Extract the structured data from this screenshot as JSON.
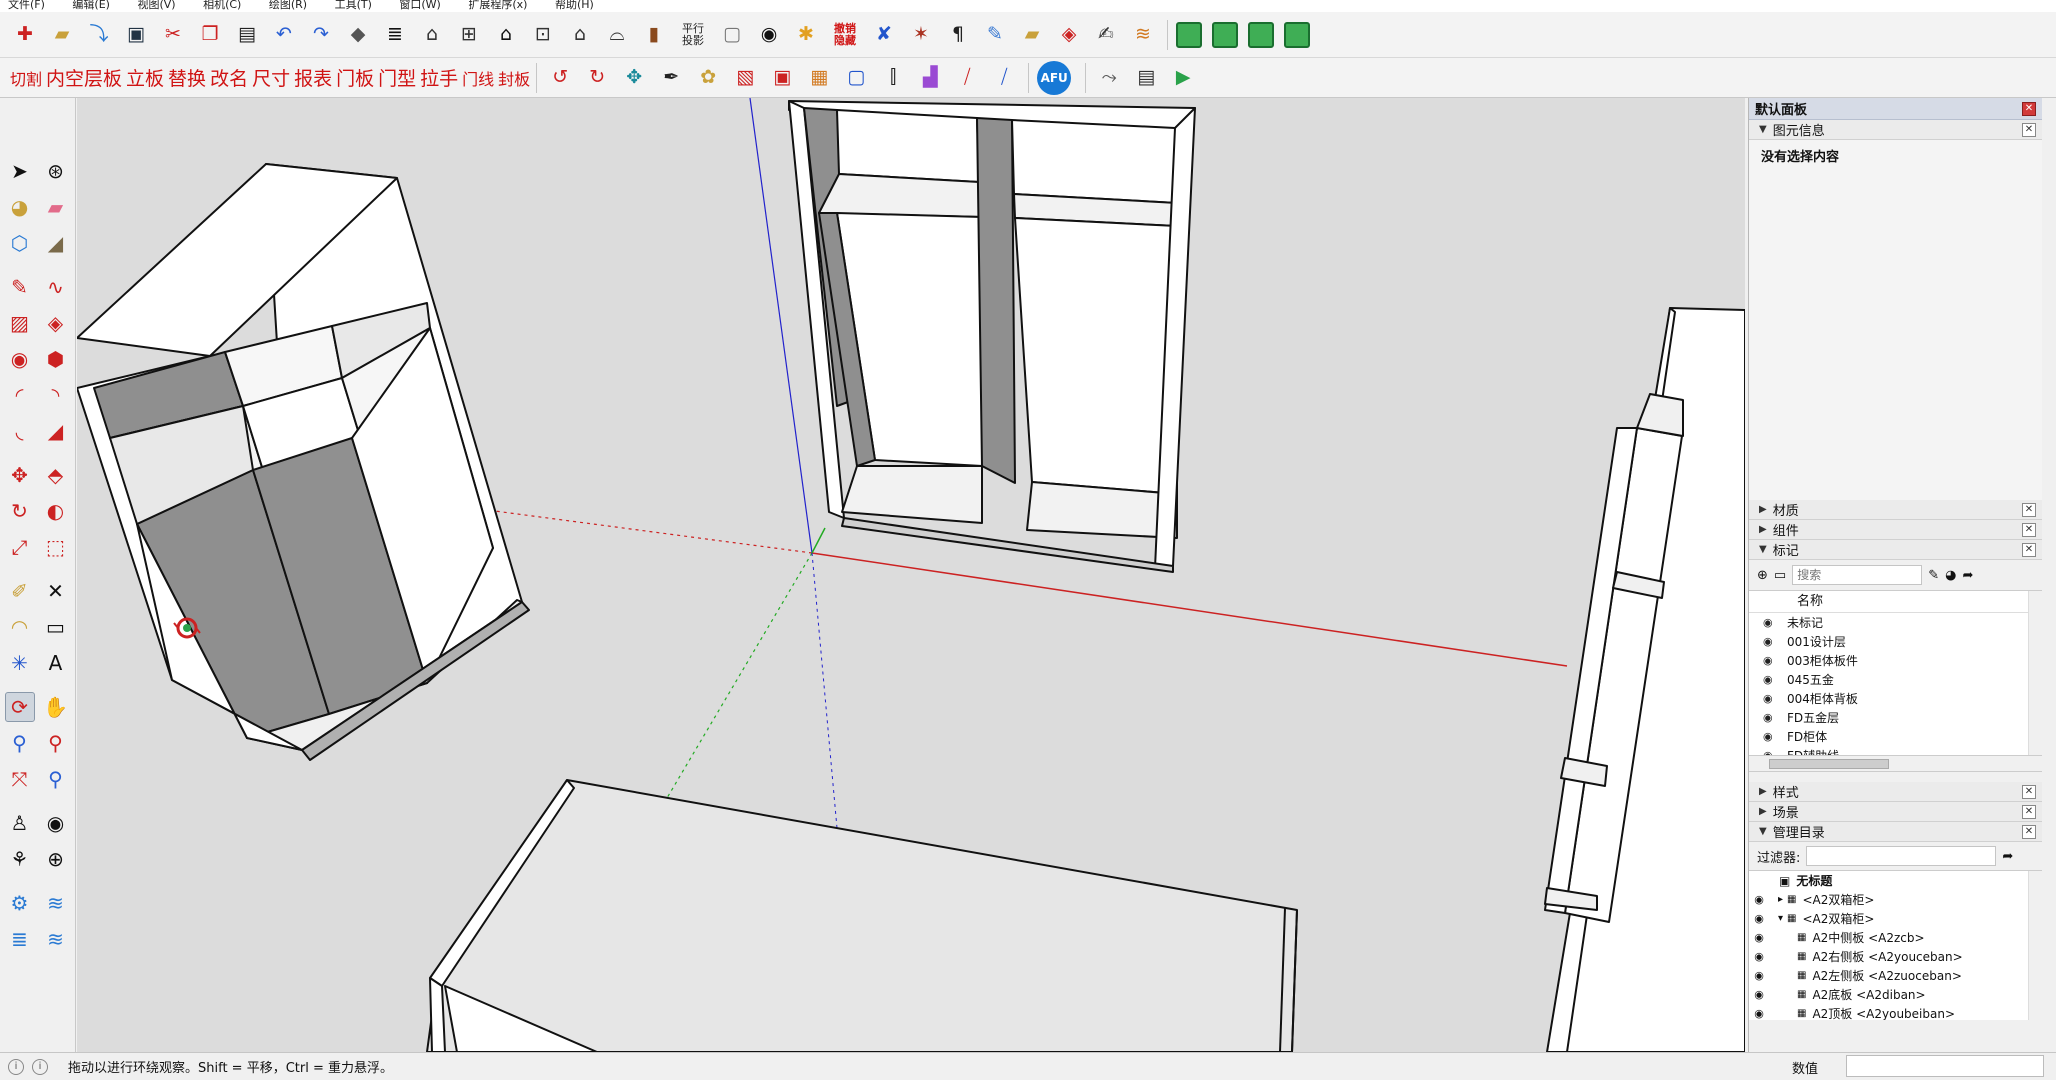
{
  "menubar": [
    "文件(F)",
    "编辑(E)",
    "视图(V)",
    "相机(C)",
    "绘图(R)",
    "工具(T)",
    "窗口(W)",
    "扩展程序(x)",
    "帮助(H)"
  ],
  "toolbar1": {
    "text_btn_parallel": "平行\n投影",
    "text_btn_undo_hide": "撤销\n隐藏"
  },
  "toolbar2": {
    "custom_buttons": [
      "切割",
      "内空层板",
      "立板",
      "替换",
      "改名",
      "尺寸",
      "报表",
      "门板",
      "门型",
      "拉手",
      "门线",
      "封板"
    ],
    "afu_label": "AFU"
  },
  "tray": {
    "title": "默认面板",
    "entity_info": {
      "label": "图元信息",
      "empty_text": "没有选择内容"
    },
    "materials_label": "材质",
    "components_label": "组件",
    "tags": {
      "label": "标记",
      "search_placeholder": "搜索",
      "column_name": "名称",
      "items": [
        "未标记",
        "001设计层",
        "003柜体板件",
        "045五金",
        "004柜体背板",
        "FD五金层",
        "FD柜体",
        "FD辅助线"
      ]
    },
    "styles_label": "样式",
    "scenes_label": "场景",
    "outliner": {
      "label": "管理目录",
      "filter_label": "过滤器:",
      "root": "无标题",
      "rows": [
        {
          "text": "<A2双箱柜>",
          "indent": 1,
          "expander": "▸"
        },
        {
          "text": "<A2双箱柜>",
          "indent": 1,
          "expander": "▾"
        },
        {
          "text": "A2中侧板 <A2zcb>",
          "indent": 2,
          "expander": ""
        },
        {
          "text": "A2右侧板 <A2youceban>",
          "indent": 2,
          "expander": ""
        },
        {
          "text": "A2左侧板 <A2zuoceban>",
          "indent": 2,
          "expander": ""
        },
        {
          "text": "A2底板 <A2diban>",
          "indent": 2,
          "expander": ""
        },
        {
          "text": "A2顶板 <A2youbeiban>",
          "indent": 2,
          "expander": ""
        }
      ]
    }
  },
  "statusbar": {
    "message": "拖动以进行环绕观察。Shift = 平移，Ctrl = 重力悬浮。",
    "measurements_label": "数值"
  },
  "colors": {
    "viewport_bg": "#dcdcdc",
    "panel_face": "#ffffff",
    "panel_shadow": "#8c8c8c",
    "axis_red": "#cc2222",
    "axis_green": "#22aa22",
    "axis_blue": "#2222cc",
    "brand_red": "#d01414"
  }
}
